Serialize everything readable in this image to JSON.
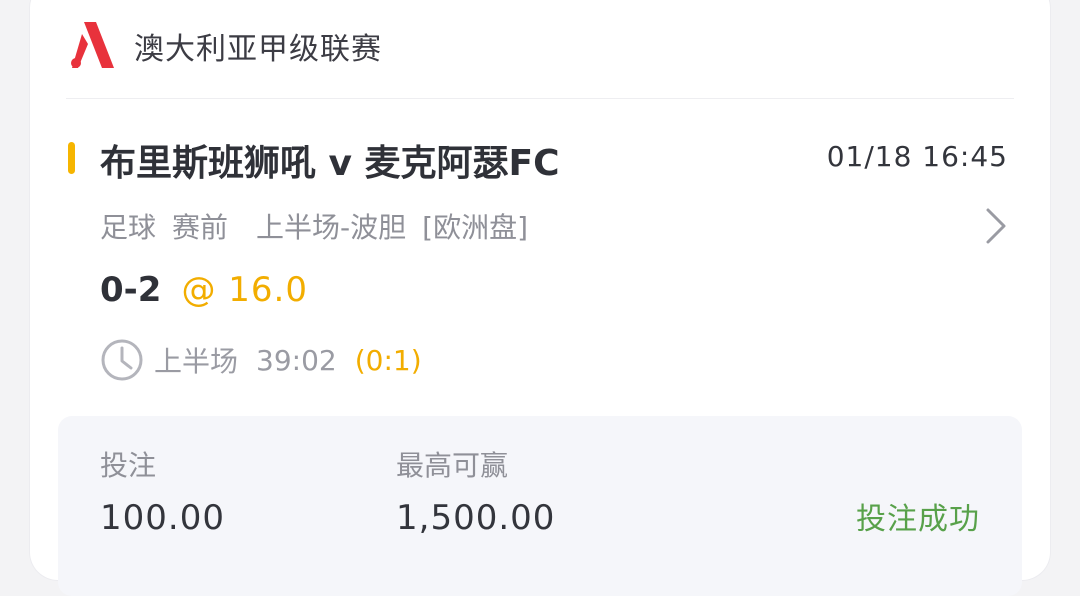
{
  "league": {
    "name": "澳大利亚甲级联赛",
    "logo_icon": "brand-logo-icon"
  },
  "match": {
    "title": "布里斯班狮吼 v 麦克阿瑟FC",
    "time": "01/18 16:45",
    "accent_color": "#f6b500"
  },
  "meta": {
    "sport": "足球",
    "stage": "赛前",
    "market": "上半场-波胆",
    "odds_type": "[欧洲盘]"
  },
  "pick": {
    "selection": "0-2",
    "odds": "@ 16.0"
  },
  "live": {
    "period": "上半场",
    "elapsed": "39:02",
    "score": "(0:1)"
  },
  "bet": {
    "stake_label": "投注",
    "stake_value": "100.00",
    "max_win_label": "最高可赢",
    "max_win_value": "1,500.00",
    "status": "投注成功",
    "status_color": "#58a14a"
  }
}
